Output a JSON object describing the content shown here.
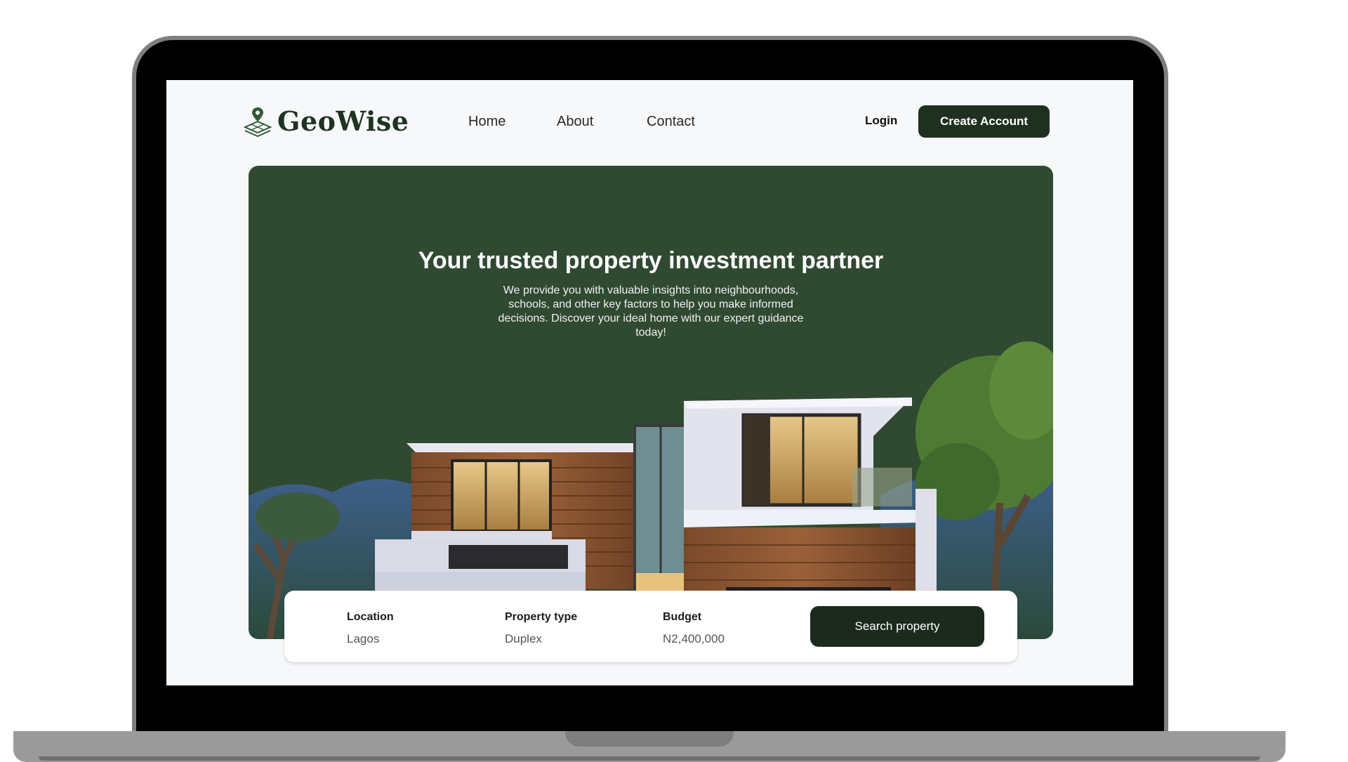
{
  "brand": {
    "name": "GeoWise",
    "color": "#1f3321"
  },
  "nav": {
    "links": [
      "Home",
      "About",
      "Contact"
    ],
    "login_label": "Login",
    "create_account_label": "Create Account"
  },
  "hero": {
    "title": "Your trusted property investment partner",
    "description": "We provide you with valuable insights into neighbourhoods, schools, and other key factors to help you make informed decisions. Discover your ideal home with our expert guidance today!",
    "background_color": "#304a31"
  },
  "search": {
    "fields": [
      {
        "label": "Location",
        "value": "Lagos"
      },
      {
        "label": "Property type",
        "value": "Duplex"
      },
      {
        "label": "Budget",
        "value": "N2,400,000"
      }
    ],
    "button_label": "Search property"
  },
  "icons": {
    "logo": "map-pin-grid-icon"
  }
}
